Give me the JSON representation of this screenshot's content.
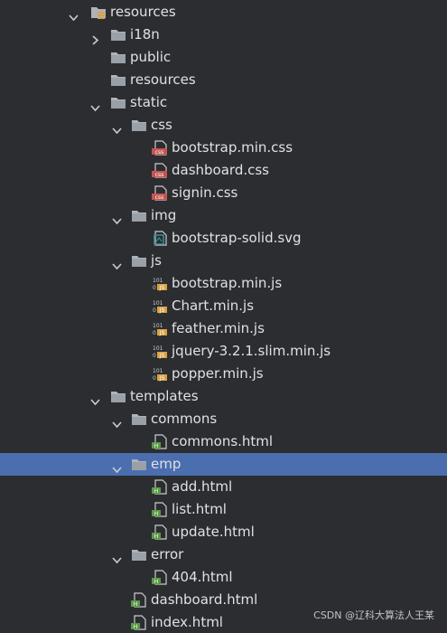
{
  "tree": {
    "rows": [
      {
        "label": "resources",
        "expanded": true,
        "icon": "resources-root-icon"
      },
      {
        "label": "i18n",
        "expanded": false,
        "icon": "folder-icon"
      },
      {
        "label": "public",
        "icon": "folder-icon"
      },
      {
        "label": "resources",
        "icon": "folder-icon"
      },
      {
        "label": "static",
        "expanded": true,
        "icon": "folder-icon"
      },
      {
        "label": "css",
        "expanded": true,
        "icon": "folder-icon"
      },
      {
        "label": "bootstrap.min.css",
        "icon": "css-file-icon"
      },
      {
        "label": "dashboard.css",
        "icon": "css-file-icon"
      },
      {
        "label": "signin.css",
        "icon": "css-file-icon"
      },
      {
        "label": "img",
        "expanded": true,
        "icon": "folder-icon"
      },
      {
        "label": "bootstrap-solid.svg",
        "icon": "svg-file-icon"
      },
      {
        "label": "js",
        "expanded": true,
        "icon": "folder-icon"
      },
      {
        "label": "bootstrap.min.js",
        "icon": "js-file-icon"
      },
      {
        "label": "Chart.min.js",
        "icon": "js-file-icon"
      },
      {
        "label": "feather.min.js",
        "icon": "js-file-icon"
      },
      {
        "label": "jquery-3.2.1.slim.min.js",
        "icon": "js-file-icon"
      },
      {
        "label": "popper.min.js",
        "icon": "js-file-icon"
      },
      {
        "label": "templates",
        "expanded": true,
        "icon": "folder-icon"
      },
      {
        "label": "commons",
        "expanded": true,
        "icon": "folder-icon"
      },
      {
        "label": "commons.html",
        "icon": "html-file-icon"
      },
      {
        "label": "emp",
        "expanded": true,
        "icon": "folder-icon",
        "selected": true
      },
      {
        "label": "add.html",
        "icon": "html-file-icon"
      },
      {
        "label": "list.html",
        "icon": "html-file-icon"
      },
      {
        "label": "update.html",
        "icon": "html-file-icon"
      },
      {
        "label": "error",
        "expanded": true,
        "icon": "folder-icon"
      },
      {
        "label": "404.html",
        "icon": "html-file-icon"
      },
      {
        "label": "dashboard.html",
        "icon": "html-file-icon"
      },
      {
        "label": "index.html",
        "icon": "html-file-icon"
      }
    ]
  },
  "watermark": "CSDN @辽科大算法人王某",
  "colors": {
    "background": "#2b2d30",
    "selection": "#4b6eaf",
    "text": "#dfe1e5",
    "folder": "#aeb3bb",
    "css_badge": "#c75450",
    "js_badge": "#d9a343",
    "html_badge": "#5a9b46",
    "svg_badge": "#3d8f8f"
  }
}
